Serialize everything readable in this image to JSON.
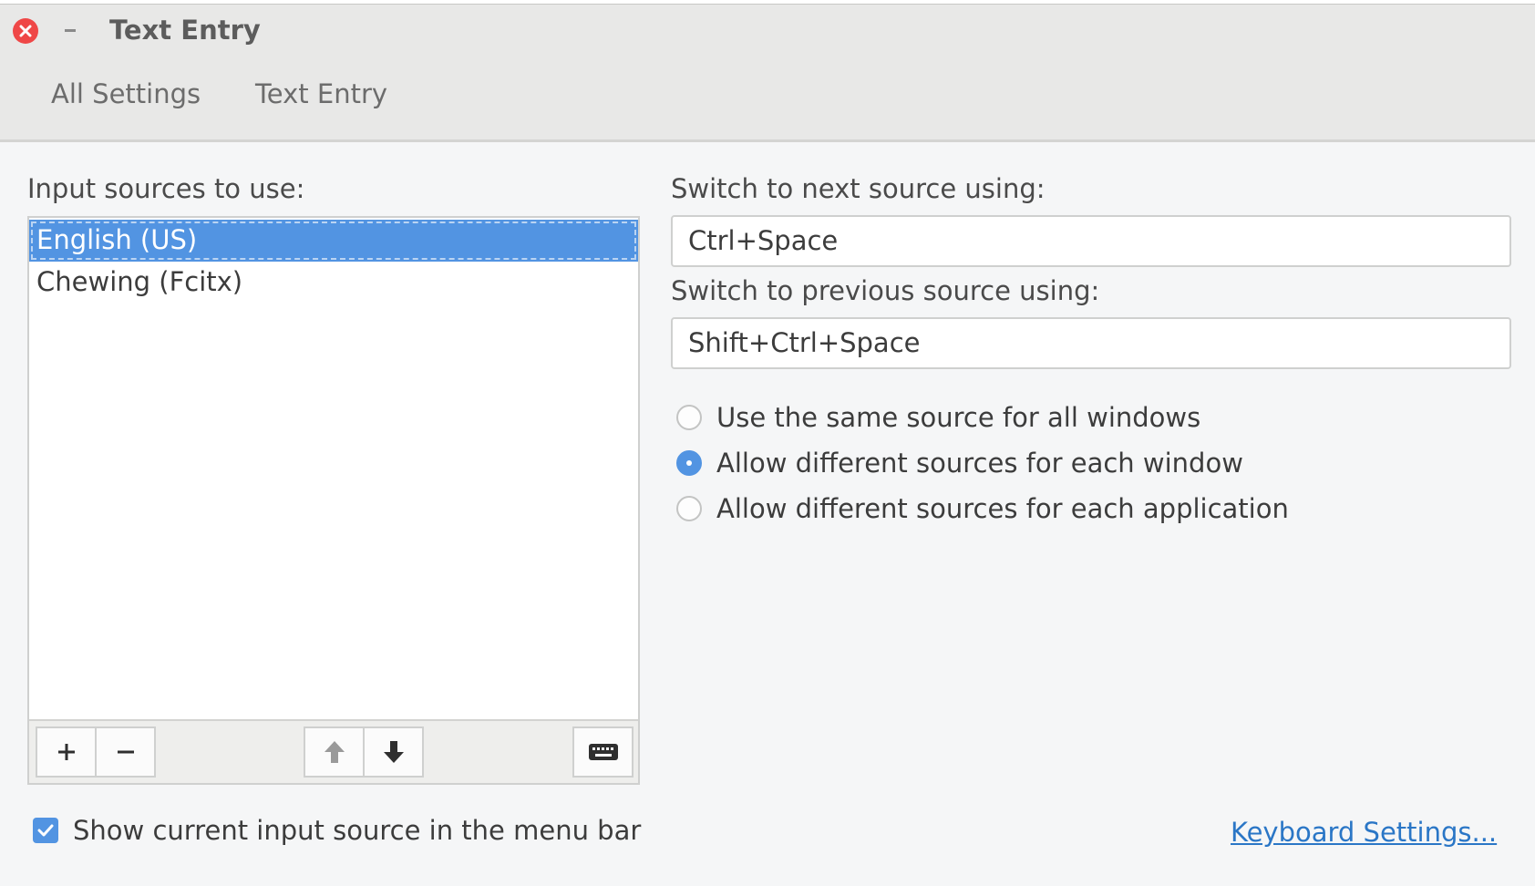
{
  "window": {
    "title": "Text Entry"
  },
  "breadcrumb": {
    "items": [
      {
        "label": "All Settings"
      },
      {
        "label": "Text Entry"
      }
    ]
  },
  "input_sources": {
    "label": "Input sources to use:",
    "items": [
      {
        "label": "English (US)",
        "selected": true
      },
      {
        "label": "Chewing (Fcitx)",
        "selected": false
      }
    ],
    "toolbar": {
      "add_icon": "plus-icon",
      "remove_icon": "minus-icon",
      "up_icon": "arrow-up-icon",
      "down_icon": "arrow-down-icon",
      "keyboard_icon": "keyboard-icon"
    }
  },
  "shortcuts": {
    "next_label": "Switch to next source using:",
    "next_value": "Ctrl+Space",
    "previous_label": "Switch to previous source using:",
    "previous_value": "Shift+Ctrl+Space"
  },
  "source_mode": {
    "options": [
      {
        "label": "Use the same source for all windows",
        "checked": false
      },
      {
        "label": "Allow different sources for each window",
        "checked": true
      },
      {
        "label": "Allow different sources for each application",
        "checked": false
      }
    ]
  },
  "menu_bar_option": {
    "label": "Show current input source in the menu bar",
    "checked": true
  },
  "keyboard_settings_link": "Keyboard Settings...",
  "colors": {
    "accent": "#5294e2",
    "close": "#ef4747",
    "link": "#2a76c6",
    "header_bg": "#e8e8e7",
    "body_bg": "#f5f6f7"
  }
}
